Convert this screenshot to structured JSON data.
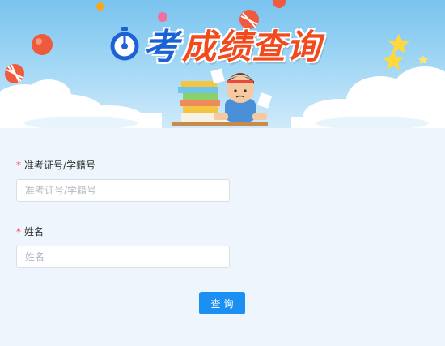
{
  "header": {
    "logo_brand": "考",
    "title": "成绩查询"
  },
  "form": {
    "fields": [
      {
        "required_mark": "*",
        "label": "准考证号/学籍号",
        "placeholder": "准考证号/学籍号",
        "value": ""
      },
      {
        "required_mark": "*",
        "label": "姓名",
        "placeholder": "姓名",
        "value": ""
      }
    ],
    "submit_label": "查询"
  },
  "colors": {
    "accent": "#1c8ff3",
    "title": "#f24a1c",
    "brand": "#1a62d6",
    "required": "#ff3333"
  }
}
